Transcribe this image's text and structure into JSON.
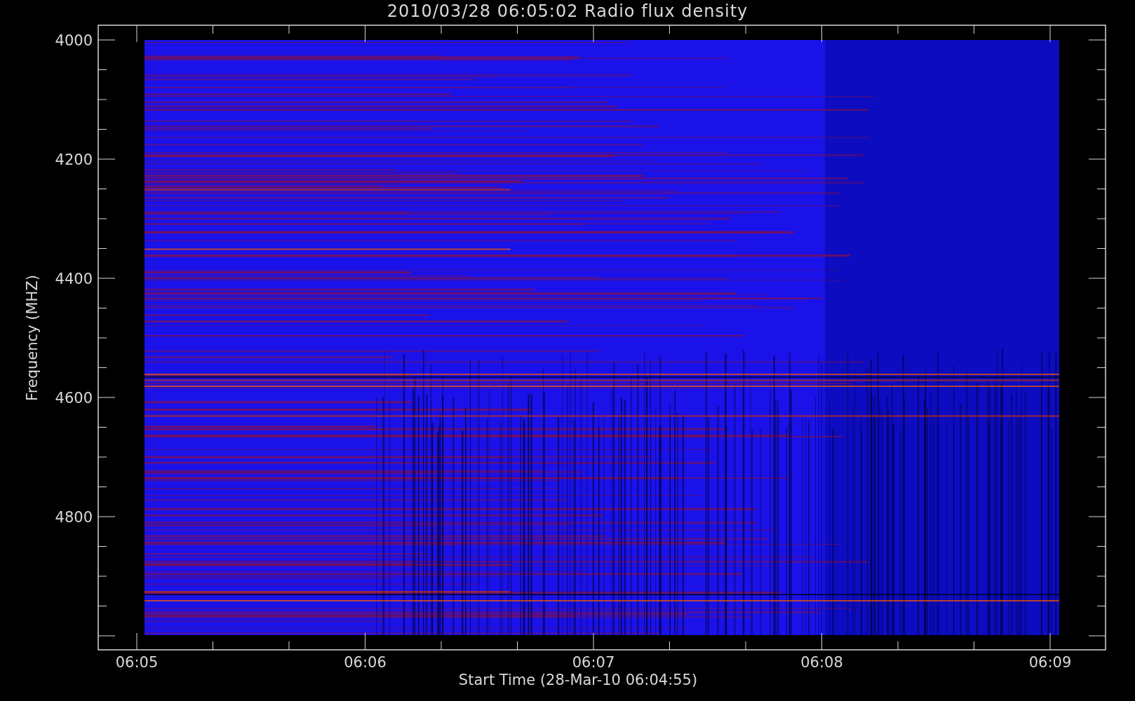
{
  "title": "2010/03/28 06:05:02 Radio flux density",
  "y_axis": {
    "label": "Frequency (MHZ)",
    "ticks": [
      "4000",
      "4200",
      "4400",
      "4600",
      "4800"
    ]
  },
  "x_axis": {
    "label": "Start Time (28-Mar-10 06:04:55)",
    "ticks": [
      "06:05",
      "06:06",
      "06:07",
      "06:08",
      "06:09"
    ]
  }
}
